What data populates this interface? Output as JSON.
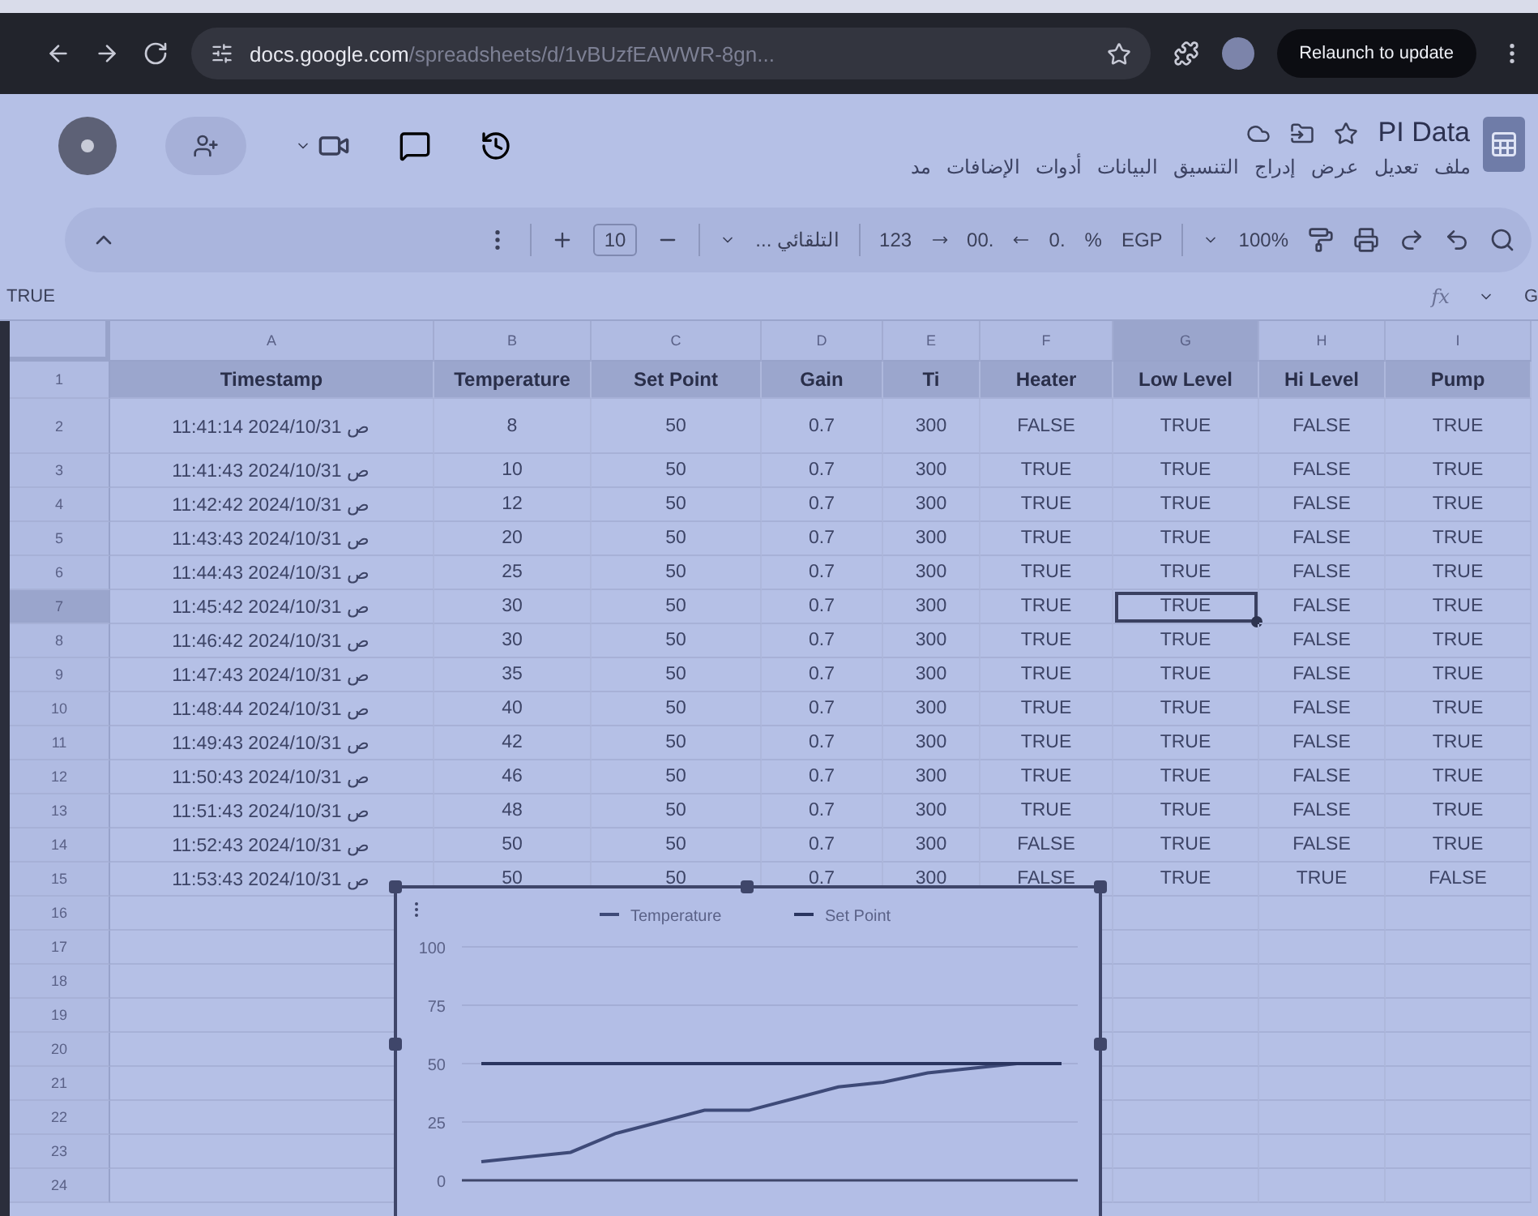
{
  "browser": {
    "url_host": "docs.google.com",
    "url_path": "/spreadsheets/d/1vBUzfEAWWR-8gn...",
    "relaunch": "Relaunch to update"
  },
  "document": {
    "title": "PI Data"
  },
  "menu": [
    "ملف",
    "تعديل",
    "عرض",
    "إدراج",
    "التنسيق",
    "البيانات",
    "أدوات",
    "الإضافات",
    "مد"
  ],
  "toolbar": {
    "zoom": "100%",
    "currency": "EGP",
    "percent": "%",
    "decrease_decimal": ".0",
    "increase_decimal": ".00",
    "number_format": "123",
    "font": "التلقائي ...",
    "font_size": "10"
  },
  "formula_bar": {
    "content": "TRUE",
    "fx_label": "fx",
    "name_box": "G"
  },
  "sheet": {
    "columns": [
      {
        "label": "A",
        "selected": false
      },
      {
        "label": "B",
        "selected": false
      },
      {
        "label": "C",
        "selected": false
      },
      {
        "label": "D",
        "selected": false
      },
      {
        "label": "E",
        "selected": false
      },
      {
        "label": "F",
        "selected": false
      },
      {
        "label": "G",
        "selected": true
      },
      {
        "label": "H",
        "selected": false
      },
      {
        "label": "I",
        "selected": false
      }
    ],
    "rows": [
      {
        "number": "1",
        "selected": false,
        "kind": "header",
        "cells": [
          "Timestamp",
          "Temperature",
          "Set Point",
          "Gain",
          "Ti",
          "Heater",
          "Low Level",
          "Hi Level",
          "Pump"
        ]
      },
      {
        "number": "2",
        "selected": false,
        "kind": "tall",
        "cells": [
          "11:41:14 2024/10/31 ص",
          "8",
          "50",
          "0.7",
          "300",
          "FALSE",
          "TRUE",
          "FALSE",
          "TRUE"
        ]
      },
      {
        "number": "3",
        "selected": false,
        "kind": "data",
        "cells": [
          "11:41:43 2024/10/31 ص",
          "10",
          "50",
          "0.7",
          "300",
          "TRUE",
          "TRUE",
          "FALSE",
          "TRUE"
        ]
      },
      {
        "number": "4",
        "selected": false,
        "kind": "data",
        "cells": [
          "11:42:42 2024/10/31 ص",
          "12",
          "50",
          "0.7",
          "300",
          "TRUE",
          "TRUE",
          "FALSE",
          "TRUE"
        ]
      },
      {
        "number": "5",
        "selected": false,
        "kind": "data",
        "cells": [
          "11:43:43 2024/10/31 ص",
          "20",
          "50",
          "0.7",
          "300",
          "TRUE",
          "TRUE",
          "FALSE",
          "TRUE"
        ]
      },
      {
        "number": "6",
        "selected": false,
        "kind": "data",
        "cells": [
          "11:44:43 2024/10/31 ص",
          "25",
          "50",
          "0.7",
          "300",
          "TRUE",
          "TRUE",
          "FALSE",
          "TRUE"
        ]
      },
      {
        "number": "7",
        "selected": true,
        "kind": "data",
        "cells": [
          "11:45:42 2024/10/31 ص",
          "30",
          "50",
          "0.7",
          "300",
          "TRUE",
          "TRUE",
          "FALSE",
          "TRUE"
        ]
      },
      {
        "number": "8",
        "selected": false,
        "kind": "data",
        "cells": [
          "11:46:42 2024/10/31 ص",
          "30",
          "50",
          "0.7",
          "300",
          "TRUE",
          "TRUE",
          "FALSE",
          "TRUE"
        ]
      },
      {
        "number": "9",
        "selected": false,
        "kind": "data",
        "cells": [
          "11:47:43 2024/10/31 ص",
          "35",
          "50",
          "0.7",
          "300",
          "TRUE",
          "TRUE",
          "FALSE",
          "TRUE"
        ]
      },
      {
        "number": "10",
        "selected": false,
        "kind": "data",
        "cells": [
          "11:48:44 2024/10/31 ص",
          "40",
          "50",
          "0.7",
          "300",
          "TRUE",
          "TRUE",
          "FALSE",
          "TRUE"
        ]
      },
      {
        "number": "11",
        "selected": false,
        "kind": "data",
        "cells": [
          "11:49:43 2024/10/31 ص",
          "42",
          "50",
          "0.7",
          "300",
          "TRUE",
          "TRUE",
          "FALSE",
          "TRUE"
        ]
      },
      {
        "number": "12",
        "selected": false,
        "kind": "data",
        "cells": [
          "11:50:43 2024/10/31 ص",
          "46",
          "50",
          "0.7",
          "300",
          "TRUE",
          "TRUE",
          "FALSE",
          "TRUE"
        ]
      },
      {
        "number": "13",
        "selected": false,
        "kind": "data",
        "cells": [
          "11:51:43 2024/10/31 ص",
          "48",
          "50",
          "0.7",
          "300",
          "TRUE",
          "TRUE",
          "FALSE",
          "TRUE"
        ]
      },
      {
        "number": "14",
        "selected": false,
        "kind": "data",
        "cells": [
          "11:52:43 2024/10/31 ص",
          "50",
          "50",
          "0.7",
          "300",
          "FALSE",
          "TRUE",
          "FALSE",
          "TRUE"
        ]
      },
      {
        "number": "15",
        "selected": false,
        "kind": "data",
        "cells": [
          "11:53:43 2024/10/31 ص",
          "50",
          "50",
          "0.7",
          "300",
          "FALSE",
          "TRUE",
          "TRUE",
          "FALSE"
        ]
      },
      {
        "number": "16",
        "selected": false,
        "kind": "empty"
      },
      {
        "number": "17",
        "selected": false,
        "kind": "empty"
      },
      {
        "number": "18",
        "selected": false,
        "kind": "empty"
      },
      {
        "number": "19",
        "selected": false,
        "kind": "empty"
      },
      {
        "number": "20",
        "selected": false,
        "kind": "empty"
      },
      {
        "number": "21",
        "selected": false,
        "kind": "empty"
      },
      {
        "number": "22",
        "selected": false,
        "kind": "empty"
      },
      {
        "number": "23",
        "selected": false,
        "kind": "empty"
      },
      {
        "number": "24",
        "selected": false,
        "kind": "empty"
      }
    ]
  },
  "chart": {
    "chart_data": {
      "type": "line",
      "grid": true,
      "legend": true,
      "series": [
        {
          "name": "Temperature",
          "color": "#3e4a78",
          "values": [
            8,
            10,
            12,
            20,
            25,
            30,
            30,
            35,
            40,
            42,
            46,
            48,
            50,
            50
          ]
        },
        {
          "name": "Set Point",
          "color": "#2a3560",
          "values": [
            50,
            50,
            50,
            50,
            50,
            50,
            50,
            50,
            50,
            50,
            50,
            50,
            50,
            50
          ]
        }
      ],
      "ylim": [
        0,
        100
      ],
      "yticks": [
        0,
        25,
        50,
        75,
        100
      ]
    }
  }
}
